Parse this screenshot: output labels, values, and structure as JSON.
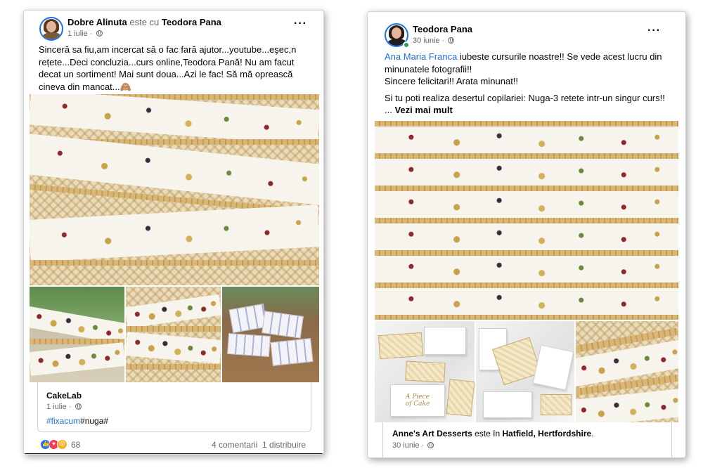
{
  "left_post": {
    "author": "Dobre Alinuta",
    "with_text": " este cu ",
    "tagged": "Teodora Pana",
    "date": "1 iulie",
    "text": "Sinceră sa fiu,am incercat să o fac fară ajutor...youtube...eşec,n rețete...Deci concluzia...curs online,Teodora Pană!  Nu am facut decat un sortiment! Mai sunt doua...Azi le fac!  Să mă oprească cineva din mancat...🙈",
    "shared_page": "CakeLab",
    "shared_date": "1 iulie",
    "hashtag_link": "#fixacum",
    "hashtag_plain": "#nuga#",
    "reaction_count": "68",
    "comments": "4 comentarii",
    "shares": "1 distribuire",
    "more_icon": "more-horizontal-icon"
  },
  "right_post": {
    "author": "Teodora Pana",
    "date": "30 iunie",
    "mention": "Ana Maria Franca",
    "line1_rest": " iubeste cursurile noastre!! Se vede acest lucru din minunatele fotografii!!",
    "line2": "Sincere felicitari!! Arata minunat!!",
    "line3": "Si tu poti realiza desertul copilariei: Nuga-3 retete intr-un singur curs!!",
    "ellipsis": "... ",
    "see_more": "Vezi mai mult",
    "shared_page": "Anne's Art Desserts",
    "shared_middle": " este în ",
    "shared_location": "Hatfield, Hertfordshire",
    "shared_end": ".",
    "shared_date": "30 iunie",
    "box_lettering": "A Piece of Cake",
    "more_icon": "more-horizontal-icon"
  },
  "colors": {
    "link": "#216fdb",
    "like": "#1877f2",
    "love": "#f33e58",
    "wow": "#f7b125",
    "online": "#31a24c",
    "meta": "#65676b"
  }
}
